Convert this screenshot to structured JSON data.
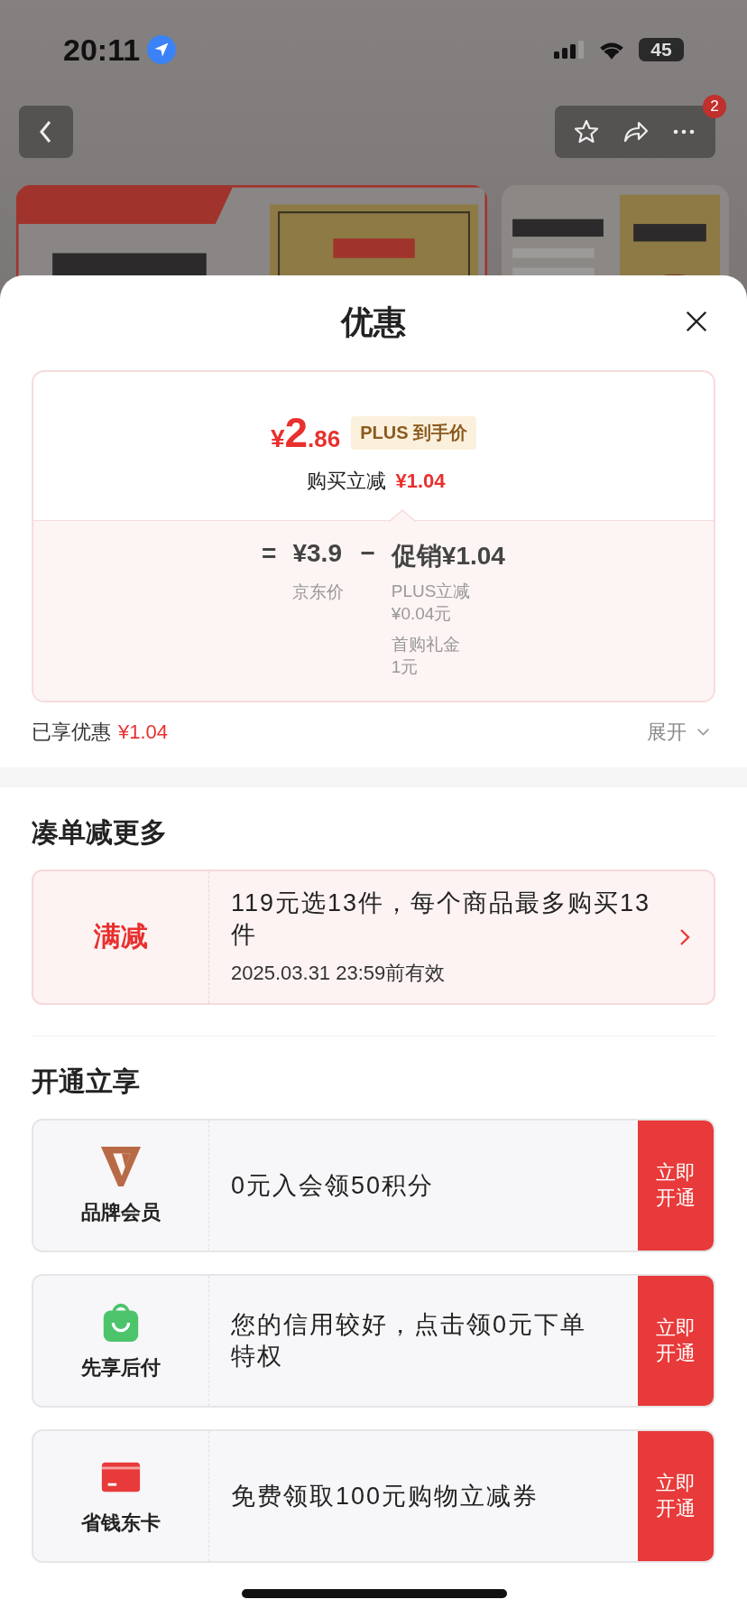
{
  "status_bar": {
    "time": "20:11",
    "battery": "45"
  },
  "nav": {
    "badge": "2"
  },
  "sheet": {
    "title": "优惠"
  },
  "price_card": {
    "currency": "¥",
    "price_int": "2",
    "price_dec": ".86",
    "tag": "PLUS 到手价",
    "reduce_label": "购买立减",
    "reduce_amount": "¥1.04",
    "formula": {
      "equals": "=",
      "base_price": "¥3.9",
      "base_label": "京东价",
      "minus": "−",
      "promo": "促销¥1.04",
      "details": [
        {
          "label": "PLUS立减",
          "amount": "¥0.04元"
        },
        {
          "label": "首购礼金",
          "amount": "1元"
        }
      ]
    }
  },
  "summary": {
    "label": "已享优惠",
    "amount": "¥1.04",
    "expand": "展开"
  },
  "bundle": {
    "title": "凑单减更多",
    "tag": "满减",
    "text": "119元选13件，每个商品最多购买13件",
    "validity": "2025.03.31 23:59前有效"
  },
  "benefits": {
    "title": "开通立享",
    "items": [
      {
        "kind": "member",
        "name": "品牌会员",
        "text": "0元入会领50积分",
        "button": "立即开通"
      },
      {
        "kind": "bag",
        "name": "先享后付",
        "text": "您的信用较好，点击领0元下单特权",
        "button": "立即开通"
      },
      {
        "kind": "card",
        "name": "省钱东卡",
        "text": "免费领取100元购物立减券",
        "button": "立即开通"
      }
    ]
  }
}
